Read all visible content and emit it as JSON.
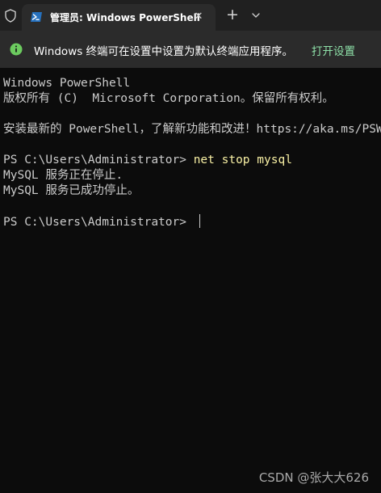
{
  "tab": {
    "title": "管理员: Windows PowerShell",
    "close_glyph": "✕",
    "new_tab_glyph": "+",
    "shield_icon": "shield-icon",
    "powershell_icon": "powershell-icon",
    "dropdown_icon": "chevron-down-icon"
  },
  "infobar": {
    "message": "Windows 终端可在设置中设置为默认终端应用程序。",
    "link": "打开设置",
    "icon": "info-icon",
    "accent": "#6ccb5f"
  },
  "terminal": {
    "lines": [
      "Windows PowerShell",
      "版权所有 (C)  Microsoft Corporation。保留所有权利。",
      "",
      "安装最新的 PowerShell，了解新功能和改进！https://aka.ms/PSWindows",
      "",
      "PS C:\\Users\\Administrator> ",
      "MySQL 服务正在停止.",
      "MySQL 服务已成功停止。",
      "",
      "PS C:\\Users\\Administrator> "
    ],
    "command": "net stop mysql",
    "command_color": "#f9f1a5"
  },
  "watermark": "CSDN @张大大626"
}
